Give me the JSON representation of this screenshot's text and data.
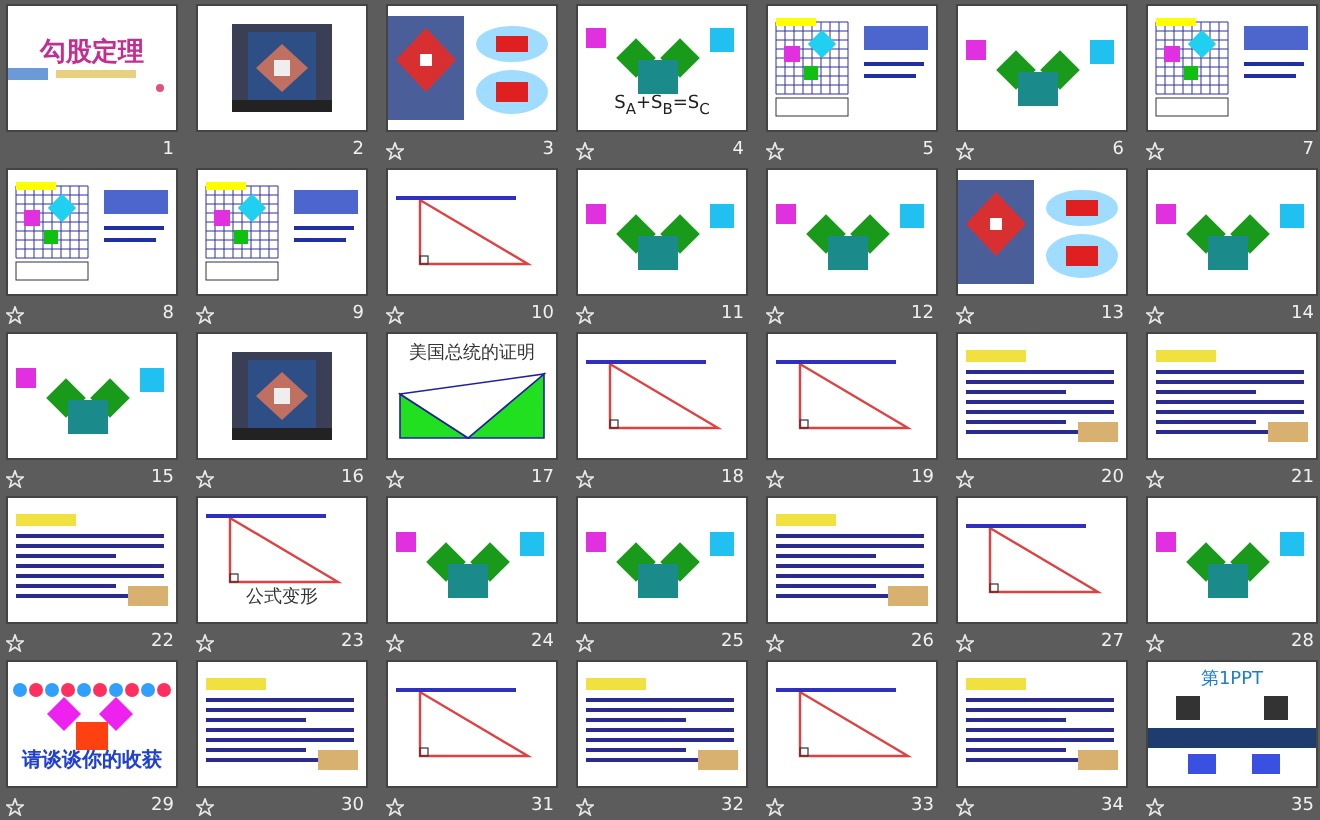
{
  "slides": [
    {
      "number": "1",
      "kind": "title",
      "title": "勾股定理",
      "star": false
    },
    {
      "number": "2",
      "kind": "picture",
      "star": false
    },
    {
      "number": "3",
      "kind": "kite",
      "star": true
    },
    {
      "number": "4",
      "kind": "squares",
      "title": "S$_{A}$+S$_{B}$=S$_{C}$",
      "star": true
    },
    {
      "number": "5",
      "kind": "grid",
      "star": true
    },
    {
      "number": "6",
      "kind": "squares",
      "star": true
    },
    {
      "number": "7",
      "kind": "grid",
      "star": true
    },
    {
      "number": "8",
      "kind": "grid",
      "star": true
    },
    {
      "number": "9",
      "kind": "grid",
      "star": true
    },
    {
      "number": "10",
      "kind": "triangle",
      "star": true
    },
    {
      "number": "11",
      "kind": "squares",
      "star": true
    },
    {
      "number": "12",
      "kind": "squares",
      "star": true
    },
    {
      "number": "13",
      "kind": "kite",
      "star": true
    },
    {
      "number": "14",
      "kind": "squares",
      "star": true
    },
    {
      "number": "15",
      "kind": "squares",
      "star": true
    },
    {
      "number": "16",
      "kind": "picture",
      "star": true
    },
    {
      "number": "17",
      "kind": "trapezoid",
      "title": "美国总统的证明",
      "star": true
    },
    {
      "number": "18",
      "kind": "triangle",
      "star": true
    },
    {
      "number": "19",
      "kind": "triangle",
      "star": true
    },
    {
      "number": "20",
      "kind": "text",
      "star": true
    },
    {
      "number": "21",
      "kind": "text",
      "star": true
    },
    {
      "number": "22",
      "kind": "text",
      "star": true
    },
    {
      "number": "23",
      "kind": "triangle",
      "title": "公式变形",
      "star": true
    },
    {
      "number": "24",
      "kind": "squares",
      "star": true
    },
    {
      "number": "25",
      "kind": "squares",
      "star": true
    },
    {
      "number": "26",
      "kind": "text",
      "star": true
    },
    {
      "number": "27",
      "kind": "triangle",
      "star": true
    },
    {
      "number": "28",
      "kind": "squares",
      "star": true
    },
    {
      "number": "29",
      "kind": "pattern",
      "title": "请谈谈你的收获",
      "star": true
    },
    {
      "number": "30",
      "kind": "text",
      "star": true
    },
    {
      "number": "31",
      "kind": "triangle",
      "star": true
    },
    {
      "number": "32",
      "kind": "text",
      "star": true
    },
    {
      "number": "33",
      "kind": "triangle",
      "star": true
    },
    {
      "number": "34",
      "kind": "text",
      "star": true
    },
    {
      "number": "35",
      "kind": "logo",
      "title": "第1PPT",
      "star": true
    }
  ]
}
